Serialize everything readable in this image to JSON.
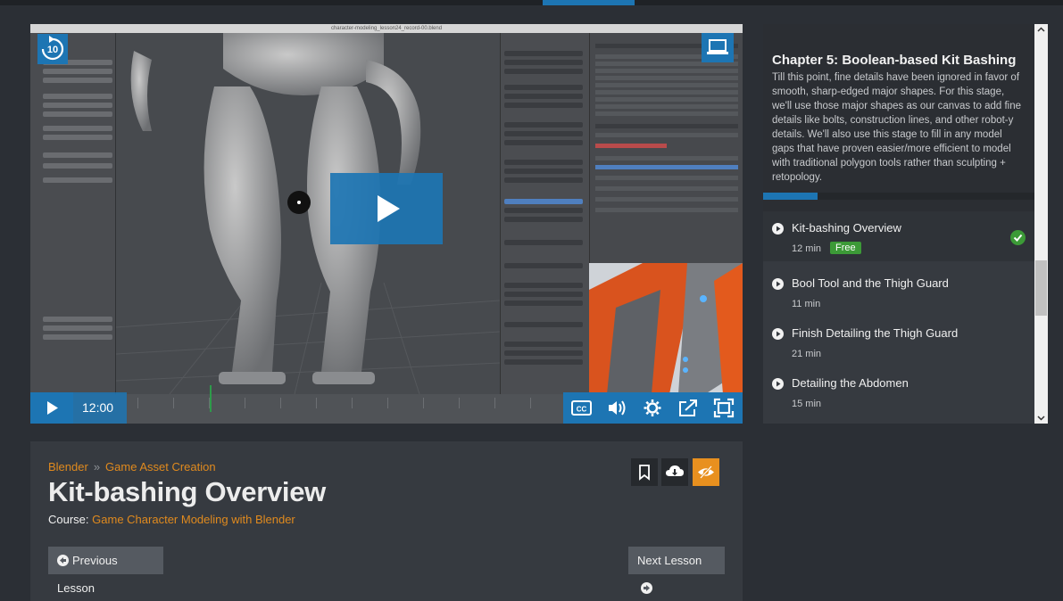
{
  "video": {
    "window_title": "character-modeling_lesson24_record-00.blend",
    "current_time": "12:00",
    "icons": [
      "rewind-10-icon",
      "laptop-icon",
      "play-icon",
      "cc-icon",
      "volume-icon",
      "settings-icon",
      "share-icon",
      "fullscreen-icon"
    ],
    "skip_seconds": "10"
  },
  "lesson": {
    "breadcrumb": [
      "Blender",
      "Game Asset Creation"
    ],
    "title": "Kit-bashing Overview",
    "course_label": "Course:",
    "course_name": "Game Character Modeling with Blender",
    "prev_label": "Previous Lesson",
    "next_label": "Next Lesson"
  },
  "sidebar": {
    "chapter_title": "Chapter 5:  Boolean-based Kit Bashing",
    "chapter_description": "Till this point, fine details have been ignored in favor of smooth, sharp-edged major shapes. For this stage, we'll use those major shapes as our canvas to add fine details like bolts, construction lines, and other robot-y details. We'll also use this stage to fill in any model gaps that have proven easier/more efficient to model with traditional polygon tools rather than sculpting + retopology.",
    "chapter_progress": 0.2,
    "lessons": [
      {
        "title": "Kit-bashing Overview",
        "duration": "12 min",
        "badge": "Free",
        "completed": true,
        "active": true
      },
      {
        "title": "Bool Tool and the Thigh Guard",
        "duration": "11 min",
        "badge": "",
        "completed": false,
        "active": false
      },
      {
        "title": "Finish Detailing the Thigh Guard",
        "duration": "21 min",
        "badge": "",
        "completed": false,
        "active": false
      },
      {
        "title": "Detailing the Abdomen",
        "duration": "15 min",
        "badge": "",
        "completed": false,
        "active": false
      }
    ]
  },
  "colors": {
    "accent_blue": "#1d75b3",
    "accent_orange": "#e08a1e",
    "free_green": "#3c9a37"
  }
}
